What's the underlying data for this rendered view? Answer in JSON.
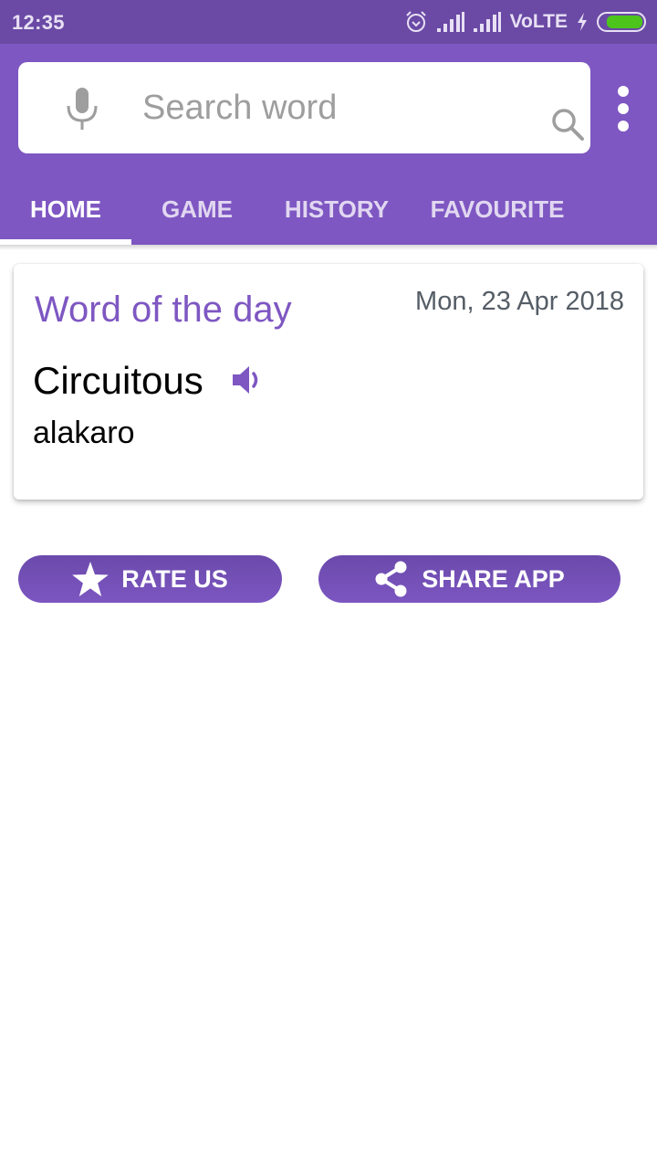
{
  "status_bar": {
    "time": "12:35",
    "network_label": "VoLTE",
    "battery_level_percent": 85,
    "icons": [
      "alarm-icon",
      "signal-icon",
      "signal-icon",
      "charging-icon",
      "battery-icon"
    ]
  },
  "search": {
    "placeholder": "Search word",
    "value": ""
  },
  "tabs": [
    {
      "label": "HOME",
      "active": true
    },
    {
      "label": "GAME",
      "active": false
    },
    {
      "label": "HISTORY",
      "active": false
    },
    {
      "label": "FAVOURITE",
      "active": false
    }
  ],
  "word_of_day": {
    "title": "Word of the day",
    "date": "Mon, 23 Apr 2018",
    "word": "Circuitous",
    "meaning": "alakaro"
  },
  "actions": {
    "rate_label": "RATE US",
    "share_label": "SHARE APP"
  },
  "colors": {
    "status_bar": "#6a4aa5",
    "primary": "#7e57c2",
    "battery_fill": "#4cc41c",
    "date_text": "#555d66"
  }
}
